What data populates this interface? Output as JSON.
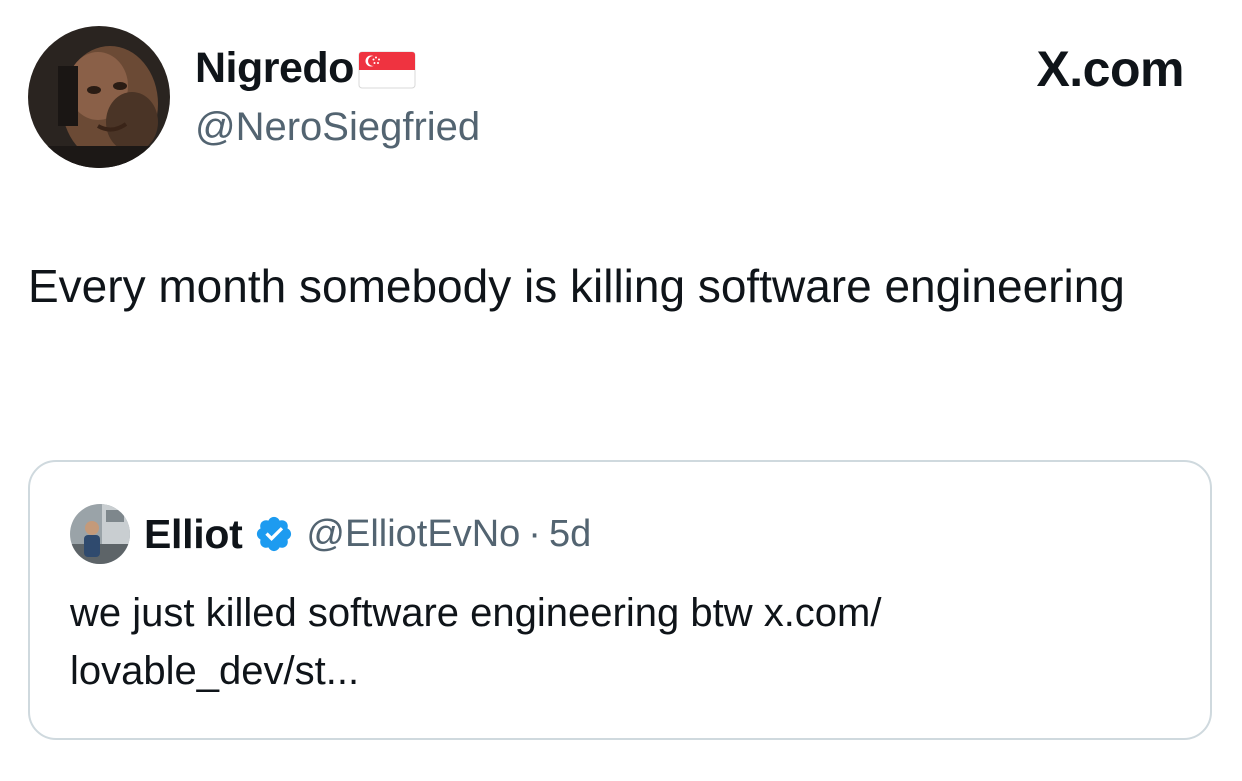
{
  "brand": {
    "label": "X.com"
  },
  "author": {
    "name": "Nigredo",
    "handle": "@NeroSiegfried",
    "flag_icon": "singapore-flag-icon",
    "avatar_icon": "profile-photo"
  },
  "tweet": {
    "text": "Every month somebody is killing software engineering"
  },
  "quoted_tweet": {
    "name": "Elliot",
    "verified_icon": "verified-badge-icon",
    "handle": "@ElliotEvNo",
    "separator": "·",
    "time": "5d",
    "text": "we just killed software engineering btw x.com/ lovable_dev/st..."
  },
  "colors": {
    "text": "#0f1419",
    "secondary_text": "#536471",
    "border": "#cfd9de",
    "verified_blue": "#1d9bf0",
    "flag_red": "#ef3340"
  }
}
